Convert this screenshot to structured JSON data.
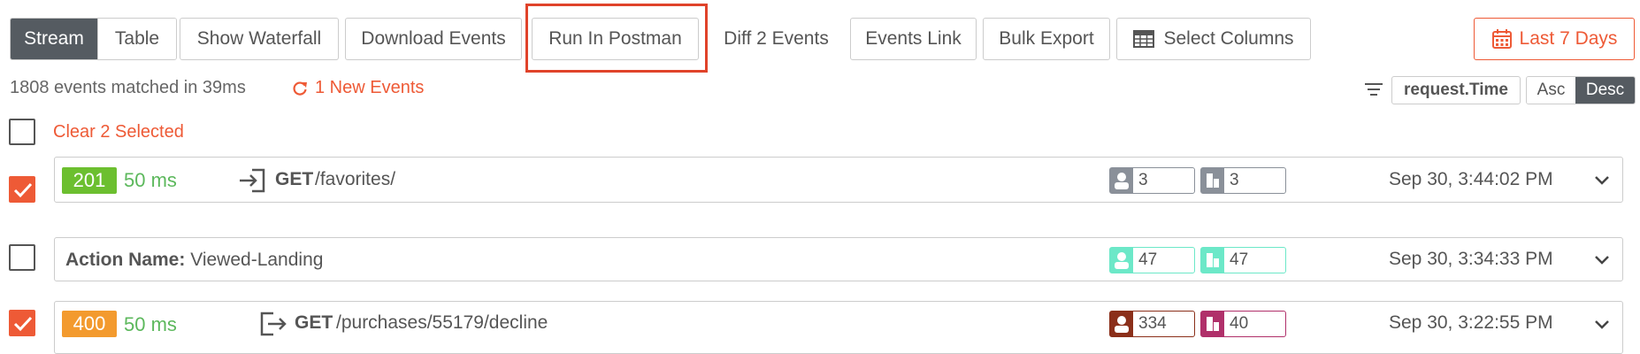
{
  "toolbar": {
    "view_stream": "Stream",
    "view_table": "Table",
    "show_waterfall": "Show Waterfall",
    "download_events": "Download Events",
    "run_in_postman": "Run In Postman",
    "diff_events": "Diff 2 Events",
    "events_link": "Events Link",
    "bulk_export": "Bulk Export",
    "select_columns": "Select Columns",
    "date_range": "Last 7 Days"
  },
  "info": {
    "matched": "1808 events matched in 39ms",
    "new_events": "1 New Events"
  },
  "sort": {
    "field": "request.Time",
    "asc": "Asc",
    "desc": "Desc",
    "active": "Desc"
  },
  "selection": {
    "clear_label": "Clear 2 Selected"
  },
  "colors": {
    "accent": "#ee5a36",
    "dark": "#555b61",
    "success": "#5cb85c",
    "status_2xx": "#6cbf2f",
    "status_4xx": "#f39a2e"
  },
  "events": [
    {
      "type": "api",
      "selected": true,
      "status": "201",
      "latency": "50 ms",
      "direction": "incoming",
      "method": "GET",
      "path": "/favorites/",
      "user_count": "3",
      "company_count": "3",
      "timestamp": "Sep 30, 3:44:02 PM"
    },
    {
      "type": "action",
      "selected": false,
      "action_label": "Action Name:",
      "action_name": "Viewed-Landing",
      "user_count": "47",
      "company_count": "47",
      "timestamp": "Sep 30, 3:34:33 PM"
    },
    {
      "type": "api",
      "selected": true,
      "status": "400",
      "latency": "50 ms",
      "direction": "outgoing",
      "method": "GET",
      "path": "/purchases/55179/decline",
      "user_count": "334",
      "company_count": "40",
      "timestamp": "Sep 30, 3:22:55 PM"
    }
  ]
}
